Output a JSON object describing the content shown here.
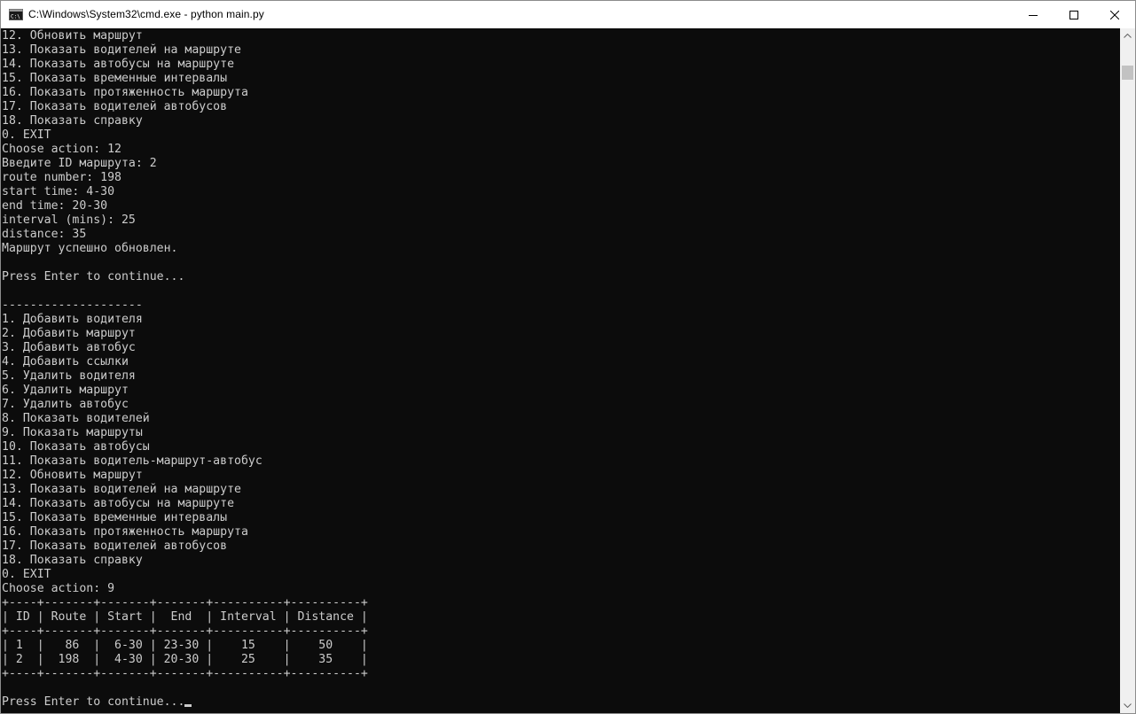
{
  "window": {
    "title": "C:\\Windows\\System32\\cmd.exe - python  main.py",
    "app_icon": "cmd-icon",
    "controls": {
      "minimize_icon": "minimize-icon",
      "maximize_icon": "maximize-icon",
      "close_icon": "close-icon"
    }
  },
  "colors": {
    "console_background": "#0c0c0c",
    "console_text": "#cccccc",
    "titlebar_background": "#ffffff",
    "scrollbar_track": "#f0f0f0",
    "scrollbar_thumb": "#c2c2c2"
  },
  "console": {
    "lines": [
      "12. Обновить маршрут",
      "13. Показать водителей на маршруте",
      "14. Показать автобусы на маршруте",
      "15. Показать временные интервалы",
      "16. Показать протяженность маршрута",
      "17. Показать водителей автобусов",
      "18. Показать справку",
      "0. EXIT",
      "Choose action: 12",
      "Введите ID маршрута: 2",
      "route number: 198",
      "start time: 4-30",
      "end time: 20-30",
      "interval (mins): 25",
      "distance: 35",
      "Маршрут успешно обновлен.",
      "",
      "Press Enter to continue...",
      "",
      "--------------------",
      "1. Добавить водителя",
      "2. Добавить маршрут",
      "3. Добавить автобус",
      "4. Добавить ссылки",
      "5. Удалить водителя",
      "6. Удалить маршрут",
      "7. Удалить автобус",
      "8. Показать водителей",
      "9. Показать маршруты",
      "10. Показать автобусы",
      "11. Показать водитель-маршрут-автобус",
      "12. Обновить маршрут",
      "13. Показать водителей на маршруте",
      "14. Показать автобусы на маршруте",
      "15. Показать временные интервалы",
      "16. Показать протяженность маршрута",
      "17. Показать водителей автобусов",
      "18. Показать справку",
      "0. EXIT",
      "Choose action: 9",
      "+----+-------+-------+-------+----------+----------+",
      "| ID | Route | Start |  End  | Interval | Distance |",
      "+----+-------+-------+-------+----------+----------+",
      "| 1  |   86  |  6-30 | 23-30 |    15    |    50    |",
      "| 2  |  198  |  4-30 | 20-30 |    25    |    35    |",
      "+----+-------+-------+-------+----------+----------+",
      "",
      "Press Enter to continue..."
    ],
    "cursor": "_"
  },
  "scrollbar": {
    "up_icon": "scroll-up-arrow-icon",
    "down_icon": "scroll-down-arrow-icon"
  }
}
